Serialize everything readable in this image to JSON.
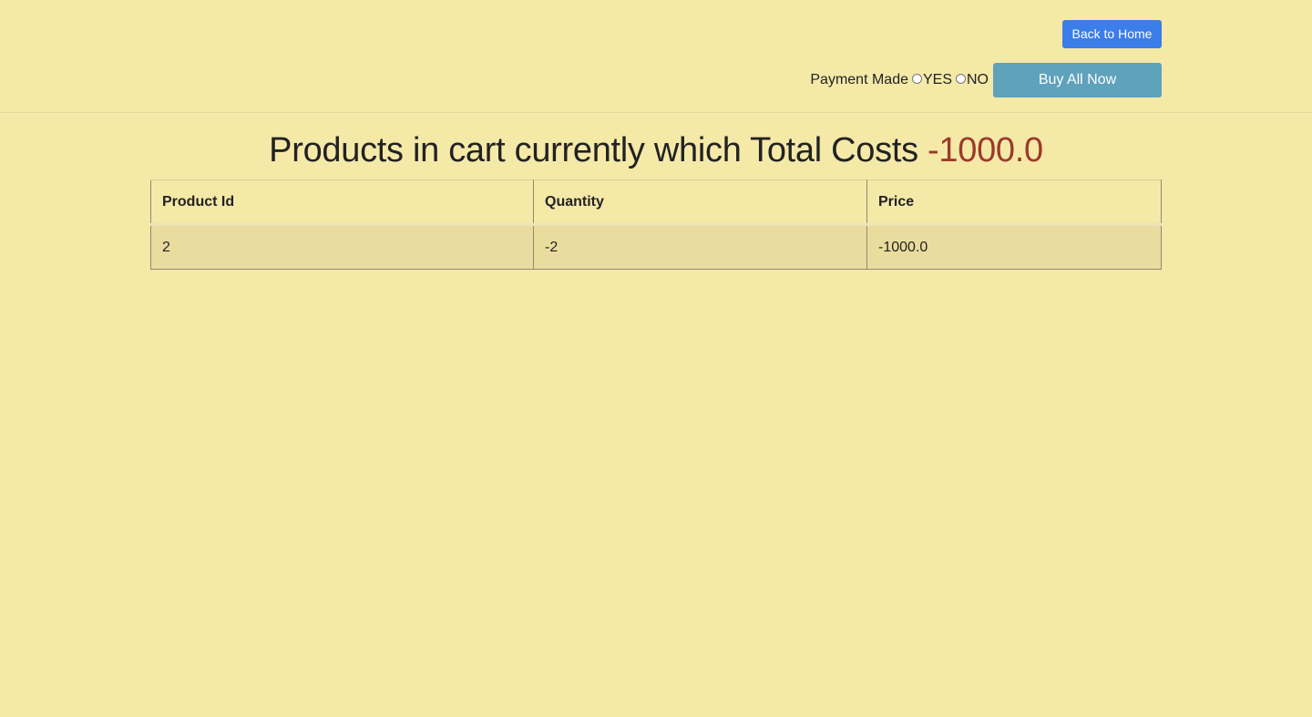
{
  "header": {
    "back_button_label": "Back to Home",
    "payment_label": "Payment Made",
    "payment_options": [
      "YES",
      "NO"
    ],
    "buy_button_label": "Buy All Now"
  },
  "main": {
    "title_prefix": "Products in cart currently which Total Costs",
    "total_cost": "-1000.0"
  },
  "table": {
    "columns": [
      "Product Id",
      "Quantity",
      "Price"
    ],
    "rows": [
      [
        "2",
        "-2",
        "-1000.0"
      ]
    ]
  },
  "colors": {
    "background": "#f5e9a8",
    "back_button": "#3b7de9",
    "buy_button": "#5fa2bb",
    "total_cost": "#9b3a2b",
    "row_background": "#eadc9f"
  },
  "icons": [
    "radio-yes-icon",
    "radio-no-icon"
  ]
}
